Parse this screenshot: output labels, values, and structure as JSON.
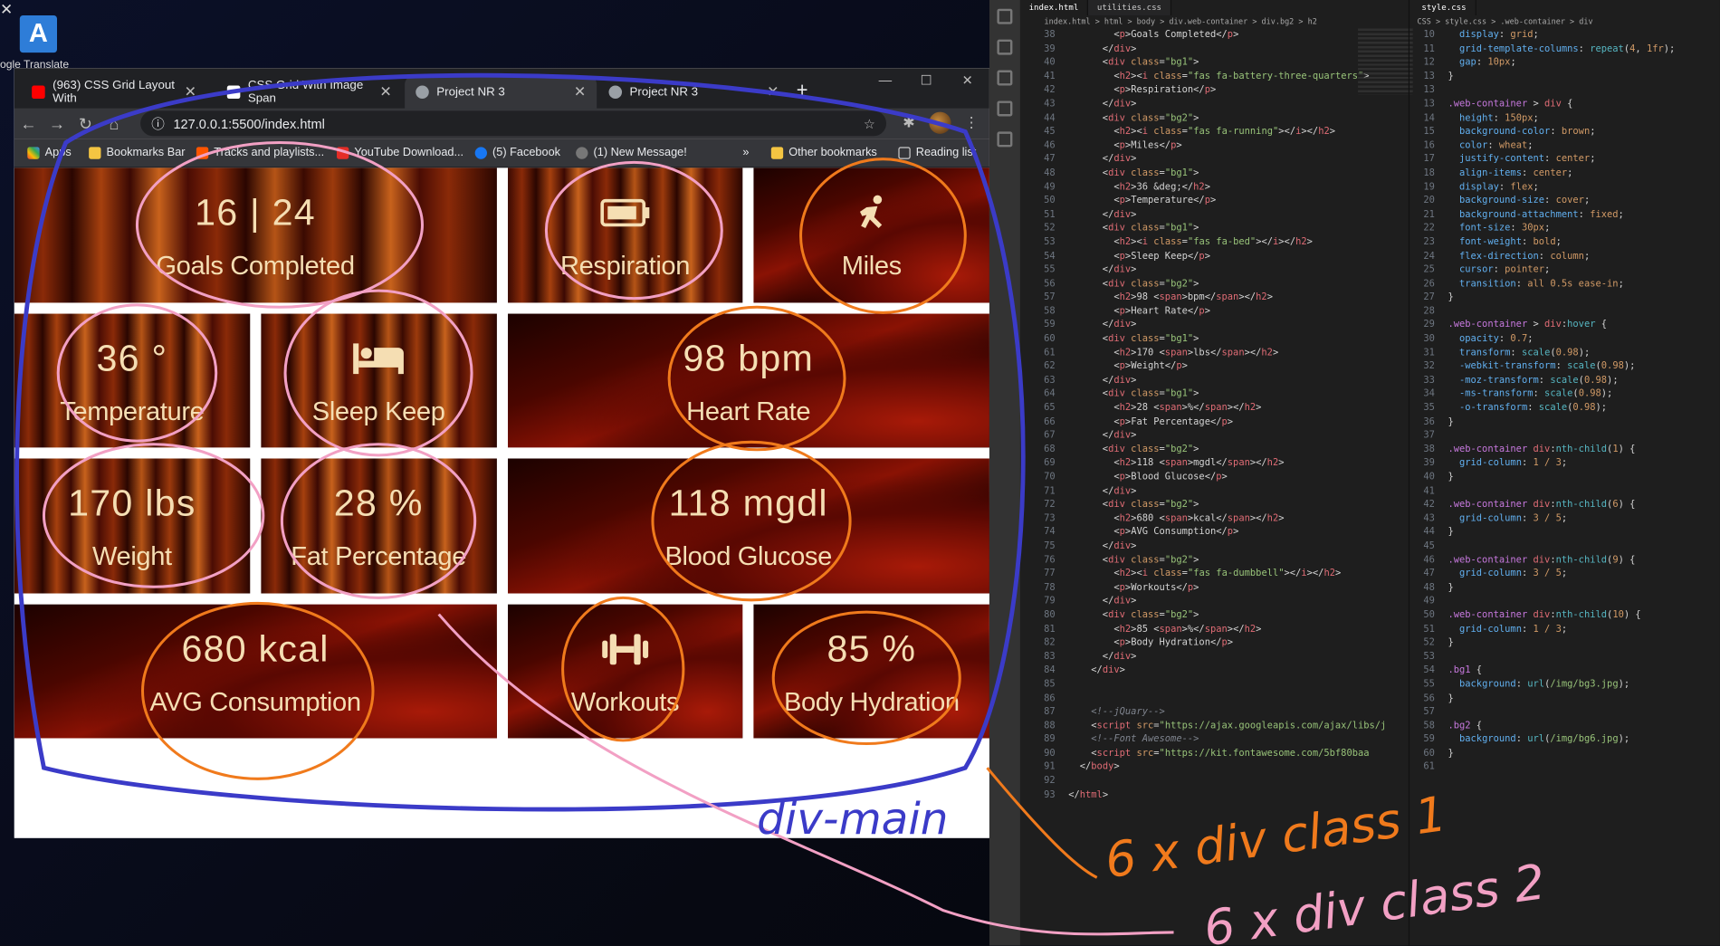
{
  "desktop": {
    "icon_letter": "A",
    "label": "ogle Translate"
  },
  "browser": {
    "tabs": [
      {
        "title": "(963) CSS Grid Layout With",
        "fav": "#ff0000"
      },
      {
        "title": "CSS Grid With Image Span",
        "fav": "#ffffff"
      },
      {
        "title": "Project NR 3",
        "fav": "#9aa0a6"
      },
      {
        "title": "Project NR 3",
        "fav": "#9aa0a6"
      }
    ],
    "url": "127.0.0.1:5500/index.html",
    "bookmarks": [
      "Apps",
      "Bookmarks Bar",
      "Tracks and playlists...",
      "YouTube Download...",
      "(5) Facebook",
      "(1) New Message!",
      "»",
      "Other bookmarks",
      "Reading list"
    ]
  },
  "dashboard": [
    {
      "value": "16 | 24",
      "label": "Goals Completed"
    },
    {
      "icon": "battery-icon",
      "label": "Respiration"
    },
    {
      "icon": "running-icon",
      "label": "Miles"
    },
    {
      "value": "36 °",
      "label": "Temperature"
    },
    {
      "icon": "bed-icon",
      "label": "Sleep Keep"
    },
    {
      "value": "98 bpm",
      "label": "Heart Rate"
    },
    {
      "value": "170 lbs",
      "label": "Weight"
    },
    {
      "value": "28 %",
      "label": "Fat Percentage"
    },
    {
      "value": "118 mgdl",
      "label": "Blood Glucose"
    },
    {
      "value": "680 kcal",
      "label": "AVG Consumption"
    },
    {
      "icon": "dumbbell-icon",
      "label": "Workouts"
    },
    {
      "value": "85 %",
      "label": "Body Hydration"
    }
  ],
  "editor": {
    "tabs": [
      "index.html",
      "utilities.css",
      "style.css"
    ],
    "breadcrumb_html": "index.html > html > body > div.web-container > div.bg2 > h2",
    "breadcrumb_css": "CSS > style.css > .web-container > div"
  },
  "annotations": {
    "main": "div-main",
    "class1": "6 x div class 1",
    "class2": "6 x div class 2"
  },
  "colors": {
    "blue_pen": "#3b3bc8",
    "pink_pen": "#f2a0c4",
    "orange_pen": "#f07a1c",
    "wheat": "#f5deb3"
  }
}
